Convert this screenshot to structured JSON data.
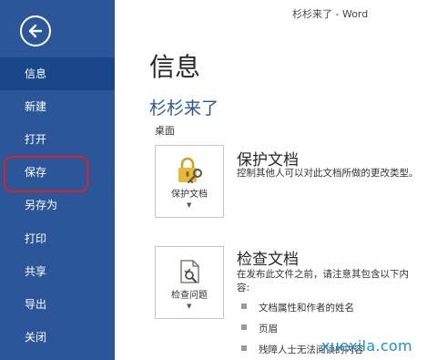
{
  "window": {
    "title": "杉杉来了 - Word"
  },
  "sidebar": {
    "items": [
      {
        "label": "信息"
      },
      {
        "label": "新建"
      },
      {
        "label": "打开"
      },
      {
        "label": "保存"
      },
      {
        "label": "另存为"
      },
      {
        "label": "打印"
      },
      {
        "label": "共享"
      },
      {
        "label": "导出"
      },
      {
        "label": "关闭"
      }
    ],
    "selected": "信息",
    "bg_color": "#2b579a",
    "highlight_color": "#e02020"
  },
  "main": {
    "title": "信息",
    "doc_name": "杉杉来了",
    "doc_location": "桌面",
    "protect": {
      "button_label": "保护文档",
      "title": "保护文档",
      "description": "控制其他人可以对此文档所做的更改类型。",
      "icon": "lock-key-icon"
    },
    "inspect": {
      "button_label": "检查问题",
      "title": "检查文档",
      "description_line1": "在发布此文件之前，请注意其包含以下内",
      "description_line2": "容:",
      "icon": "inspect-document-icon",
      "bullets": [
        "文档属性和作者的姓名",
        "页眉",
        "残障人士无法阅读的内容"
      ]
    }
  },
  "watermark": "xuexila.com",
  "colors": {
    "accent": "#2b579a",
    "watermark": "#1a8fd6"
  }
}
